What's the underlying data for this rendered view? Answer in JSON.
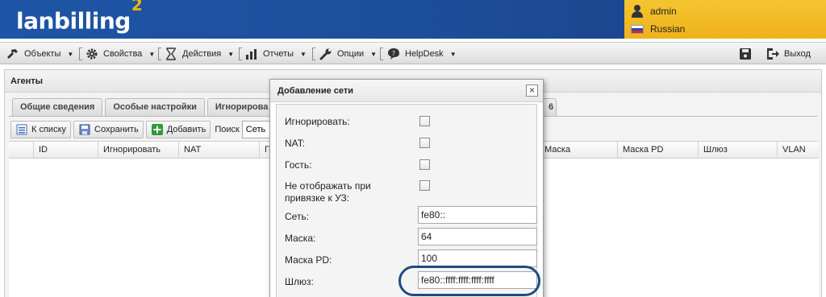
{
  "header": {
    "logo_text": "lanbilling",
    "logo_sup": "2",
    "user": "admin",
    "language": "Russian"
  },
  "menu": {
    "items": [
      {
        "label": "Объекты",
        "icon": "wrench-hammer-icon"
      },
      {
        "label": "Свойства",
        "icon": "gear-icon"
      },
      {
        "label": "Действия",
        "icon": "hourglass-icon"
      },
      {
        "label": "Отчеты",
        "icon": "bar-chart-icon"
      },
      {
        "label": "Опции",
        "icon": "wrench-icon"
      },
      {
        "label": "HelpDesk",
        "icon": "speech-bubble-icon"
      }
    ],
    "exit_label": "Выход"
  },
  "panel": {
    "title": "Агенты",
    "tabs": [
      "Общие сведения",
      "Особые настройки",
      "Игнорирова",
      "6"
    ],
    "toolbar": {
      "back_label": "К списку",
      "save_label": "Сохранить",
      "add_label": "Добавить",
      "search_label": "Поиск",
      "search_value": "Сеть"
    },
    "columns": [
      "ID",
      "Игнорировать",
      "NAT",
      "Го",
      "Маска",
      "Маска PD",
      "Шлюз",
      "VLAN"
    ]
  },
  "dialog": {
    "title": "Добавление сети",
    "close_symbol": "×",
    "fields": {
      "ignore_label": "Игнорировать:",
      "nat_label": "NAT:",
      "guest_label": "Гость:",
      "hide_label": "Не отображать при привязке к УЗ:",
      "net_label": "Сеть:",
      "net_value": "fe80::",
      "mask_label": "Маска:",
      "mask_value": "64",
      "maskpd_label": "Маска PD:",
      "maskpd_value": "100",
      "gateway_label": "Шлюз:",
      "gateway_value": "fe80::ffff:ffff:ffff:ffff"
    }
  }
}
